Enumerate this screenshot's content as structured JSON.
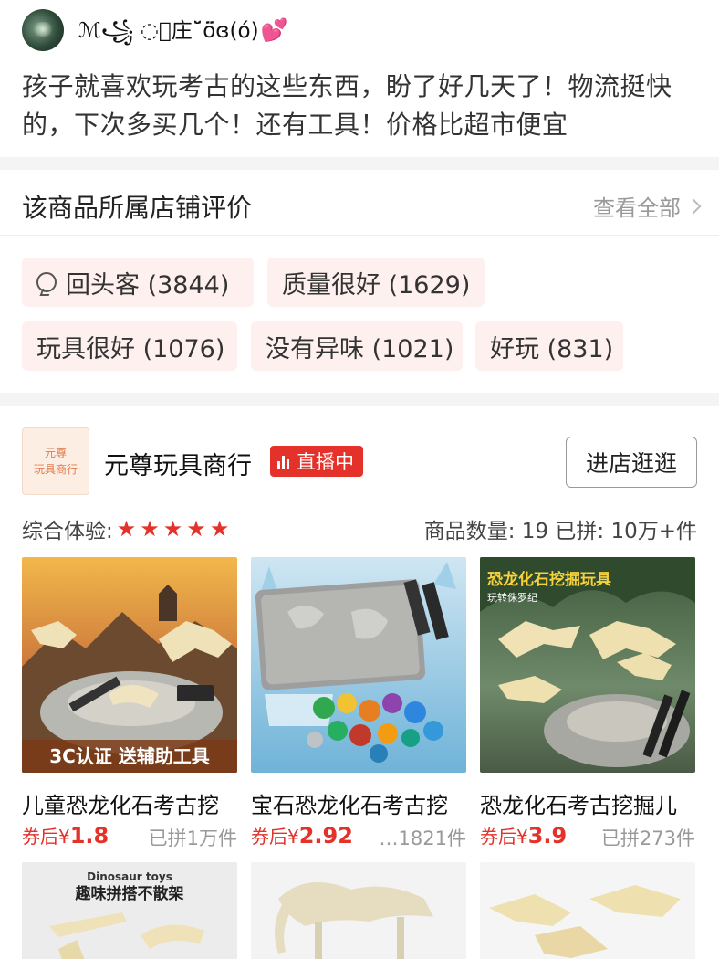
{
  "review": {
    "username": "ℳ꧁ ◌⃝庄˘̆̈ö̈ɞ(ό)",
    "heart": "💕",
    "text": "孩子就喜欢玩考古的这些东西，盼了好几天了！物流挺快的，下次多买几个！还有工具！价格比超市便宜"
  },
  "shop_rating": {
    "title": "该商品所属店铺评价",
    "see_all": "查看全部",
    "tags": [
      {
        "label": "回头客 (3844)",
        "icon": "repeat-customer-icon"
      },
      {
        "label": "质量很好 (1629)"
      },
      {
        "label": "玩具很好 (1076)"
      },
      {
        "label": "没有异味 (1021)"
      },
      {
        "label": "好玩 (831)"
      }
    ]
  },
  "shop": {
    "logo_line1": "元尊",
    "logo_line2": "玩具商行",
    "name": "元尊玩具商行",
    "live_label": "直播中",
    "enter_label": "进店逛逛",
    "experience_label": "综合体验:",
    "rating_stars": 5,
    "stats": "商品数量: 19    已拼: 10万+件",
    "products": [
      {
        "title": "儿童恐龙化石考古挖",
        "price_prefix": "券后¥",
        "price": "1.8",
        "sold": "已拼1万件",
        "image_caption": "3C认证 送辅助工具"
      },
      {
        "title": "宝石恐龙化石考古挖",
        "price_prefix": "券后¥",
        "price": "2.92",
        "sold": "…1821件"
      },
      {
        "title": "恐龙化石考古挖掘儿",
        "price_prefix": "券后¥",
        "price": "3.9",
        "sold": "已拼273件",
        "image_caption": "恐龙化石挖掘玩具",
        "image_sub": "玩转侏罗纪"
      }
    ],
    "next_row": [
      {
        "image_caption_small": "Dinosaur toys",
        "image_caption": "趣味拼搭不散架"
      },
      {},
      {}
    ]
  },
  "colors": {
    "accent": "#e4322a",
    "tag_bg": "#fdf0ee",
    "gap": "#f4f4f4"
  }
}
